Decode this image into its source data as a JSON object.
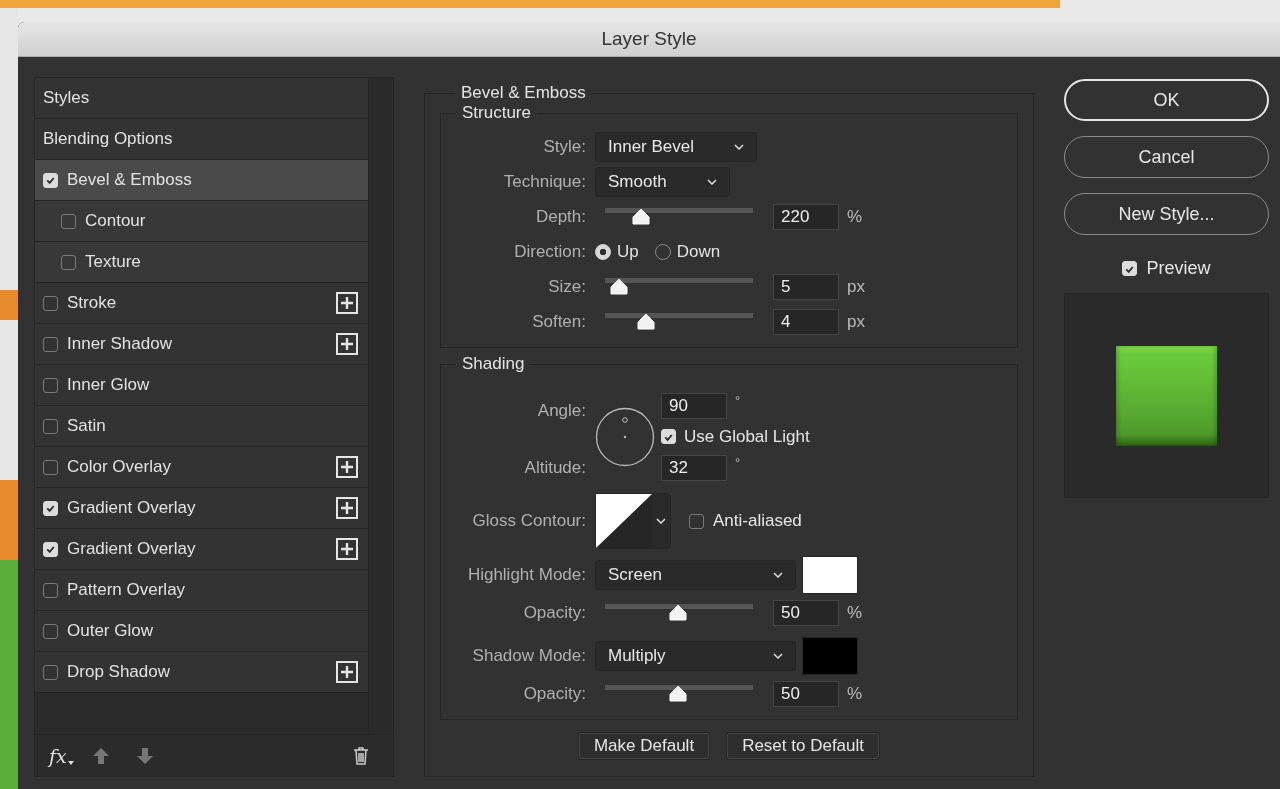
{
  "window": {
    "title": "Layer Style"
  },
  "styles_list": {
    "items": [
      {
        "label": "Styles",
        "kind": "header",
        "selected": false
      },
      {
        "label": "Blending Options",
        "kind": "header",
        "selected": false
      },
      {
        "label": "Bevel & Emboss",
        "kind": "effect",
        "checked": true,
        "selected": true,
        "addable": false,
        "children": [
          {
            "label": "Contour",
            "checked": false,
            "selected": false,
            "addable": false
          },
          {
            "label": "Texture",
            "checked": false,
            "selected": false,
            "addable": false
          }
        ]
      },
      {
        "label": "Stroke",
        "kind": "effect",
        "checked": false,
        "selected": false,
        "addable": true
      },
      {
        "label": "Inner Shadow",
        "kind": "effect",
        "checked": false,
        "selected": false,
        "addable": true
      },
      {
        "label": "Inner Glow",
        "kind": "effect",
        "checked": false,
        "selected": false,
        "addable": false
      },
      {
        "label": "Satin",
        "kind": "effect",
        "checked": false,
        "selected": false,
        "addable": false
      },
      {
        "label": "Color Overlay",
        "kind": "effect",
        "checked": false,
        "selected": false,
        "addable": true
      },
      {
        "label": "Gradient Overlay",
        "kind": "effect",
        "checked": true,
        "selected": false,
        "addable": true
      },
      {
        "label": "Gradient Overlay",
        "kind": "effect",
        "checked": true,
        "selected": false,
        "addable": true
      },
      {
        "label": "Pattern Overlay",
        "kind": "effect",
        "checked": false,
        "selected": false,
        "addable": false
      },
      {
        "label": "Outer Glow",
        "kind": "effect",
        "checked": false,
        "selected": false,
        "addable": false
      },
      {
        "label": "Drop Shadow",
        "kind": "effect",
        "checked": false,
        "selected": false,
        "addable": true
      }
    ],
    "fx_label": "fx"
  },
  "bevel_emboss": {
    "title": "Bevel & Emboss",
    "structure": {
      "title": "Structure",
      "rows": [
        {
          "kind": "select",
          "label": "Style:",
          "value": "Inner Bevel"
        },
        {
          "kind": "select",
          "label": "Technique:",
          "value": "Smooth"
        },
        {
          "kind": "slider",
          "label": "Depth:",
          "level": 0.2,
          "value": "220",
          "unit": "%"
        },
        {
          "kind": "radio",
          "label": "Direction:",
          "options": [
            {
              "label": "Up",
              "selected": true
            },
            {
              "label": "Down",
              "selected": false
            }
          ]
        },
        {
          "kind": "slider",
          "label": "Size:",
          "level": 0.03,
          "value": "5",
          "unit": "px"
        },
        {
          "kind": "slider",
          "label": "Soften:",
          "level": 0.24,
          "value": "4",
          "unit": "px"
        }
      ]
    },
    "shading": {
      "title": "Shading",
      "angle": {
        "label": "Angle:",
        "value": "90",
        "unit": "°"
      },
      "global_light": {
        "label": "Use Global Light",
        "checked": true
      },
      "altitude": {
        "label": "Altitude:",
        "value": "32",
        "unit": "°"
      },
      "gloss_contour": {
        "label": "Gloss Contour:"
      },
      "anti_aliased": {
        "label": "Anti-aliased",
        "checked": false
      },
      "modes": [
        {
          "label": "Highlight Mode:",
          "value": "Screen",
          "color": "#ffffff",
          "opacity_label": "Opacity:",
          "level": 0.49,
          "opacity": "50",
          "unit": "%"
        },
        {
          "label": "Shadow Mode:",
          "value": "Multiply",
          "color": "#000000",
          "opacity_label": "Opacity:",
          "level": 0.49,
          "opacity": "50",
          "unit": "%"
        }
      ]
    },
    "buttons": [
      "Make Default",
      "Reset to Default"
    ]
  },
  "side_buttons": [
    {
      "label": "OK",
      "default": true
    },
    {
      "label": "Cancel",
      "default": false
    },
    {
      "label": "New Style...",
      "default": false
    }
  ],
  "preview": {
    "label": "Preview",
    "checked": true
  }
}
